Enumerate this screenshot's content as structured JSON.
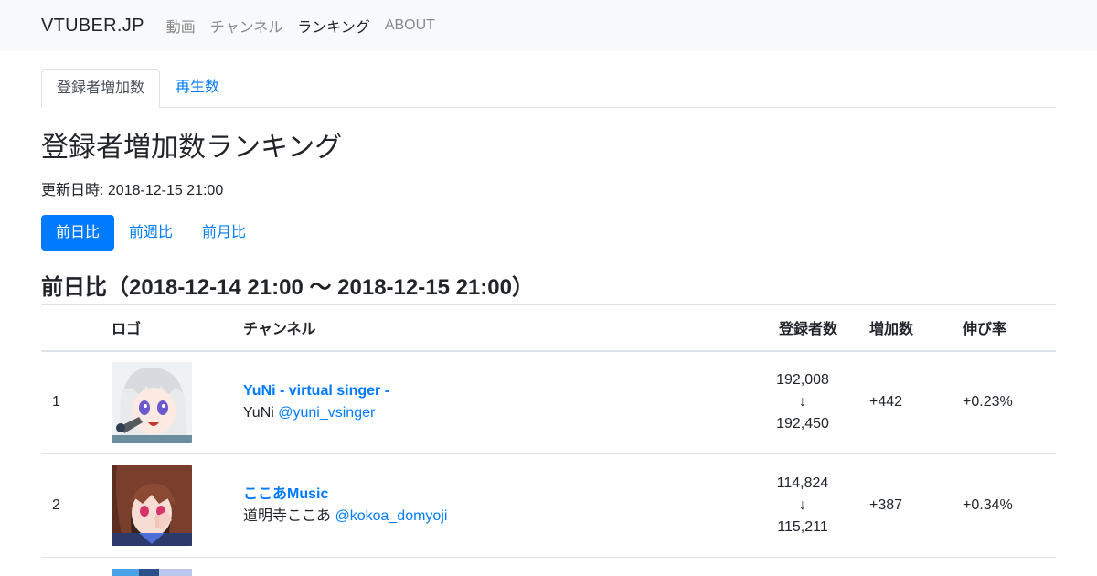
{
  "navbar": {
    "brand": "VTUBER.JP",
    "links": [
      "動画",
      "チャンネル",
      "ランキング",
      "ABOUT"
    ]
  },
  "tabs": [
    "登録者増加数",
    "再生数"
  ],
  "page": {
    "title": "登録者増加数ランキング",
    "updated": "更新日時: 2018-12-15 21:00",
    "periods": [
      "前日比",
      "前週比",
      "前月比"
    ],
    "range_title": "前日比（2018-12-14 21:00 ～ 2018-12-15 21:00）"
  },
  "table": {
    "headers": [
      "",
      "ロゴ",
      "チャンネル",
      "登録者数",
      "増加数",
      "伸び率"
    ],
    "rows": [
      {
        "rank": "1",
        "name": "YuNi - virtual singer -",
        "owner": "YuNi",
        "handle": "@yuni_vsinger",
        "subs_from": "192,008",
        "arrow": "↓",
        "subs_to": "192,450",
        "increase": "+442",
        "rate": "+0.23%"
      },
      {
        "rank": "2",
        "name": "ここあMusic",
        "owner": "道明寺ここあ",
        "handle": "@kokoa_domyoji",
        "subs_from": "114,824",
        "arrow": "↓",
        "subs_to": "115,211",
        "increase": "+387",
        "rate": "+0.34%"
      }
    ]
  },
  "colors": {
    "link": "#007bff",
    "navbar_bg": "#f8f9fa",
    "border": "#dee2e6"
  }
}
